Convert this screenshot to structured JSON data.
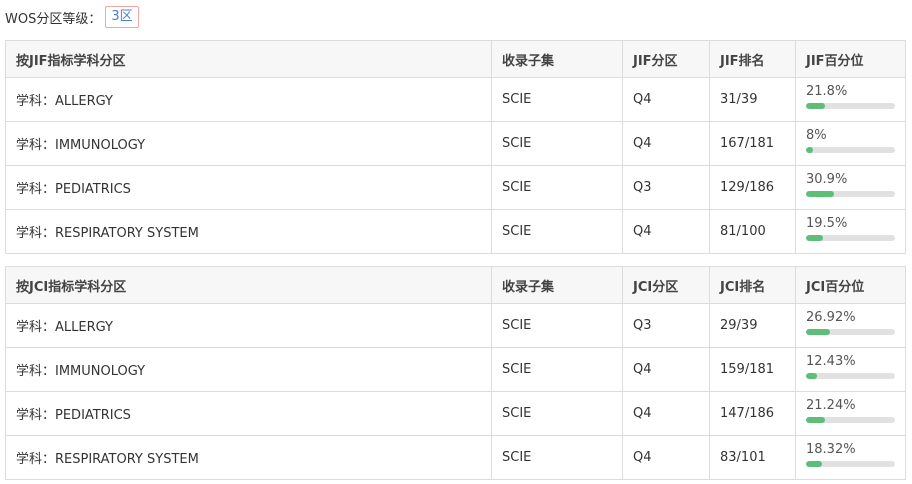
{
  "header": {
    "label": "WOS分区等级：",
    "badge": "3区"
  },
  "tables": [
    {
      "headers": [
        "按JIF指标学科分区",
        "收录子集",
        "JIF分区",
        "JIF排名",
        "JIF百分位"
      ],
      "rows": [
        {
          "subject": "学科：ALLERGY",
          "subset": "SCIE",
          "quartile": "Q4",
          "rank": "31/39",
          "percentile_text": "21.8%",
          "percentile": 21.8
        },
        {
          "subject": "学科：IMMUNOLOGY",
          "subset": "SCIE",
          "quartile": "Q4",
          "rank": "167/181",
          "percentile_text": "8%",
          "percentile": 8
        },
        {
          "subject": "学科：PEDIATRICS",
          "subset": "SCIE",
          "quartile": "Q3",
          "rank": "129/186",
          "percentile_text": "30.9%",
          "percentile": 30.9
        },
        {
          "subject": "学科：RESPIRATORY SYSTEM",
          "subset": "SCIE",
          "quartile": "Q4",
          "rank": "81/100",
          "percentile_text": "19.5%",
          "percentile": 19.5
        }
      ]
    },
    {
      "headers": [
        "按JCI指标学科分区",
        "收录子集",
        "JCI分区",
        "JCI排名",
        "JCI百分位"
      ],
      "rows": [
        {
          "subject": "学科：ALLERGY",
          "subset": "SCIE",
          "quartile": "Q3",
          "rank": "29/39",
          "percentile_text": "26.92%",
          "percentile": 26.92
        },
        {
          "subject": "学科：IMMUNOLOGY",
          "subset": "SCIE",
          "quartile": "Q4",
          "rank": "159/181",
          "percentile_text": "12.43%",
          "percentile": 12.43
        },
        {
          "subject": "学科：PEDIATRICS",
          "subset": "SCIE",
          "quartile": "Q4",
          "rank": "147/186",
          "percentile_text": "21.24%",
          "percentile": 21.24
        },
        {
          "subject": "学科：RESPIRATORY SYSTEM",
          "subset": "SCIE",
          "quartile": "Q4",
          "rank": "83/101",
          "percentile_text": "18.32%",
          "percentile": 18.32
        }
      ]
    }
  ],
  "colors": {
    "bar_fill": "#5dbe78",
    "bar_track": "#e1e1e1",
    "badge_border": "#f2a7a7",
    "badge_text": "#4d7fd1"
  }
}
